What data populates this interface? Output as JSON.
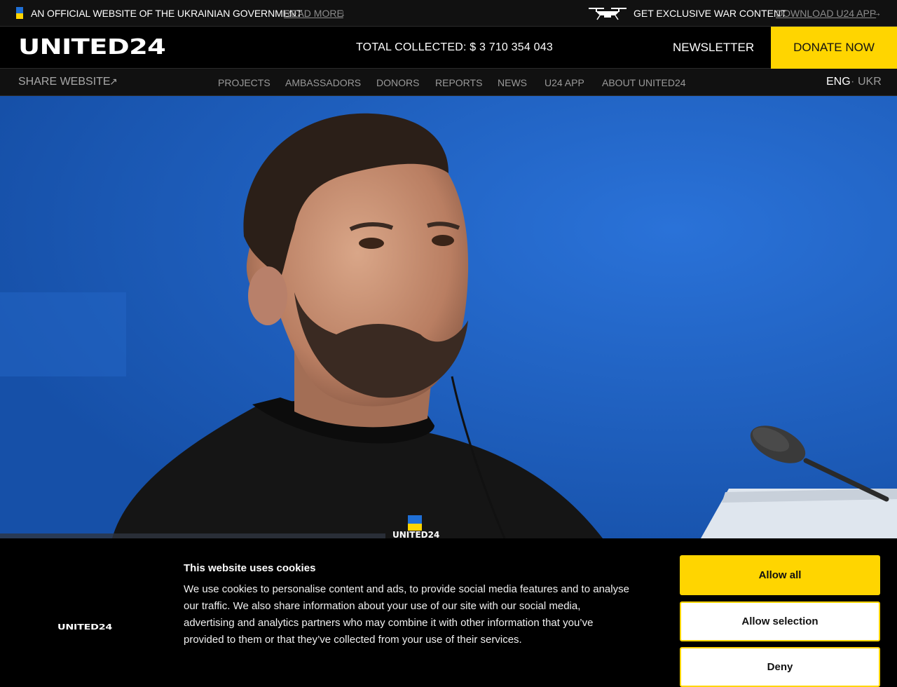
{
  "official_bar": {
    "text": "AN OFFICIAL WEBSITE OF THE UKRAINIAN GOVERNMENT",
    "read_more": "READ MORE",
    "read_more_arrow": "↓",
    "war_content": "GET EXCLUSIVE WAR CONTENT",
    "download": "DOWNLOAD U24 APP",
    "download_arrow": "→"
  },
  "header": {
    "logo": "UNITED24",
    "total_collected": "TOTAL COLLECTED: $ 3 710 354 043",
    "newsletter": "NEWSLETTER",
    "donate": "DONATE NOW"
  },
  "nav": {
    "share": "SHARE WEBSITE",
    "share_arrow": "↗",
    "items": [
      "PROJECTS",
      "AMBASSADORS",
      "DONORS",
      "REPORTS",
      "NEWS",
      "U24 APP",
      "ABOUT UNITED24"
    ],
    "lang_active": "ENG",
    "lang_sep": "·",
    "lang_other": "UKR"
  },
  "cookie": {
    "logo": "UNITED24",
    "title": "This website uses cookies",
    "text": "We use cookies to personalise content and ads, to provide social media features and to analyse our traffic. We also share information about your use of our site with our social media, advertising and analytics partners who may combine it with other information that you’ve provided to them or that they’ve collected from your use of their services.",
    "allow_all": "Allow all",
    "allow_selection": "Allow selection",
    "deny": "Deny"
  },
  "hero": {
    "sweater_logo": "UNITED24"
  },
  "colors": {
    "accent": "#ffd500",
    "hero_blue": "#1a5ec6",
    "bar_bg": "#111111"
  }
}
